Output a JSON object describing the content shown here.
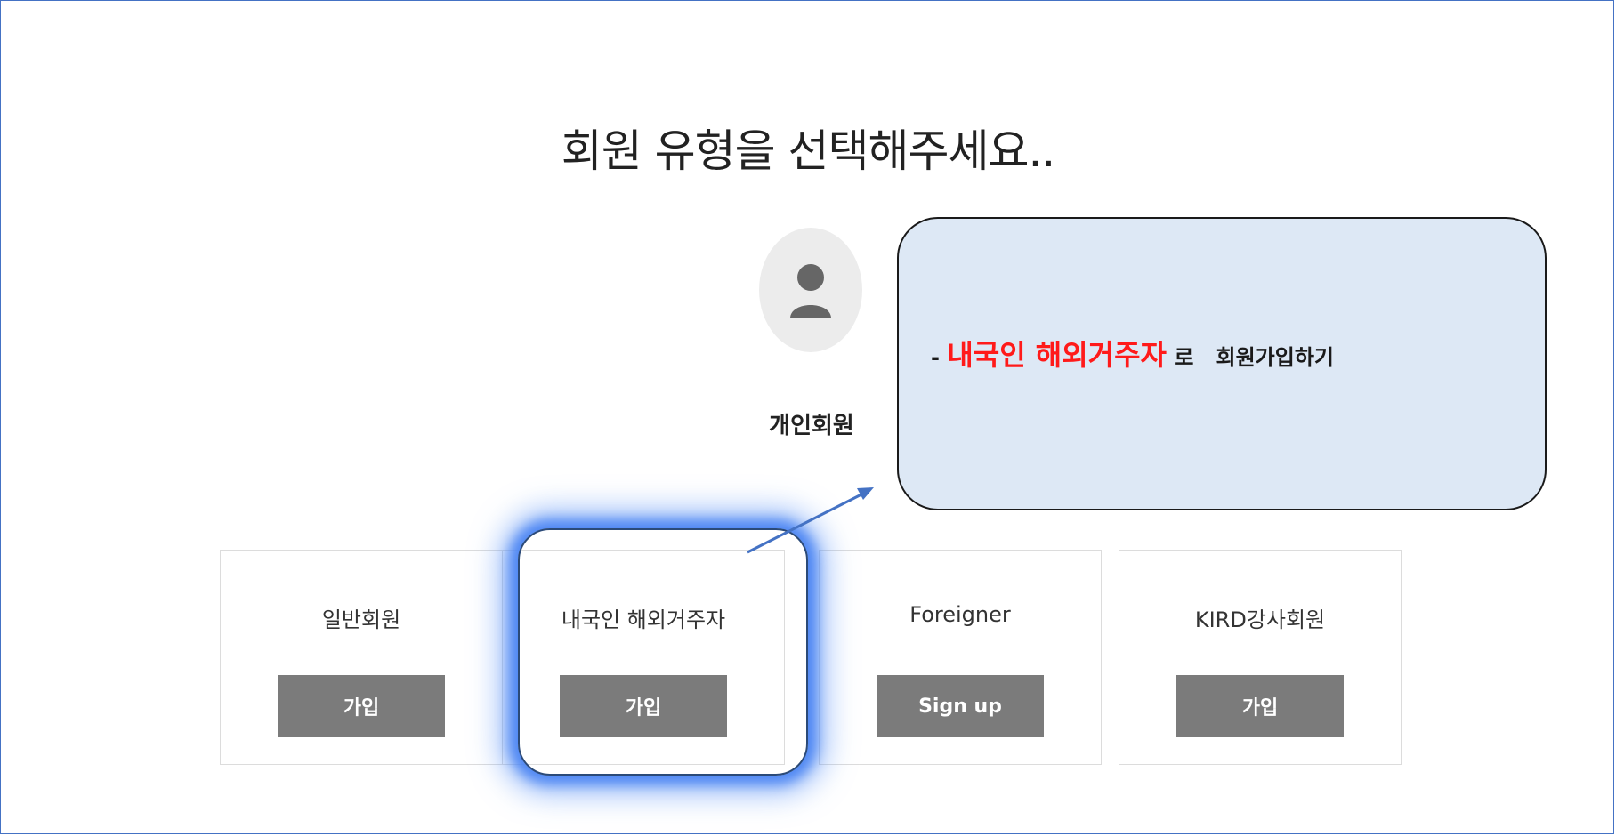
{
  "page": {
    "title": "회원 유형을 선택해주세요.."
  },
  "member": {
    "icon": "person-icon",
    "label": "개인회원"
  },
  "cards": [
    {
      "title": "일반회원",
      "button": "가입"
    },
    {
      "title": "내국인 해외거주자",
      "button": "가입"
    },
    {
      "title": "Foreigner",
      "button": "Sign up"
    },
    {
      "title": "KIRD강사회원",
      "button": "가입"
    }
  ],
  "callout": {
    "prefix": "- ",
    "emphasis": "내국인 해외거주자",
    "suffix": " 로   회원가입하기"
  },
  "colors": {
    "highlight_glow": "#4a84f2",
    "callout_bg": "#dde8f5",
    "emphasis_text": "#ff1a1a",
    "button_bg": "#7b7b7b",
    "arrow": "#4472c4"
  }
}
